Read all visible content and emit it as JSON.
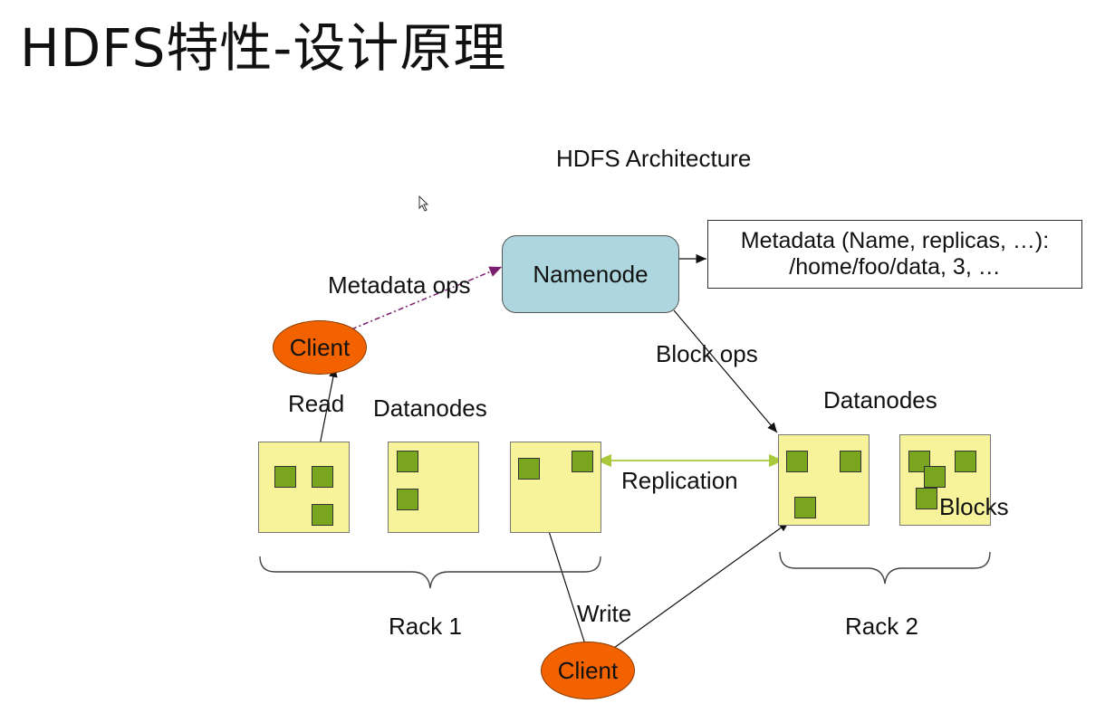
{
  "slide": {
    "title": "HDFS特性-设计原理"
  },
  "diagram": {
    "title": "HDFS Architecture",
    "namenode": "Namenode",
    "metadata": {
      "line1": "Metadata (Name, replicas, …):",
      "line2": "/home/foo/data, 3, …"
    },
    "edge_labels": {
      "metadata_ops": "Metadata ops",
      "block_ops": "Block ops",
      "read": "Read",
      "write": "Write",
      "replication": "Replication"
    },
    "clients": [
      "Client",
      "Client"
    ],
    "datanodes_label": "Datanodes",
    "blocks_label": "Blocks",
    "racks": [
      "Rack 1",
      "Rack 2"
    ]
  },
  "colors": {
    "namenode_fill": "#aed6de",
    "client_fill": "#f26300",
    "datanode_fill": "#f7f39a",
    "block_fill": "#7aa51f",
    "metadata_ops_arrow": "#7a1f6e",
    "replication_arrow": "#a8c93a"
  }
}
